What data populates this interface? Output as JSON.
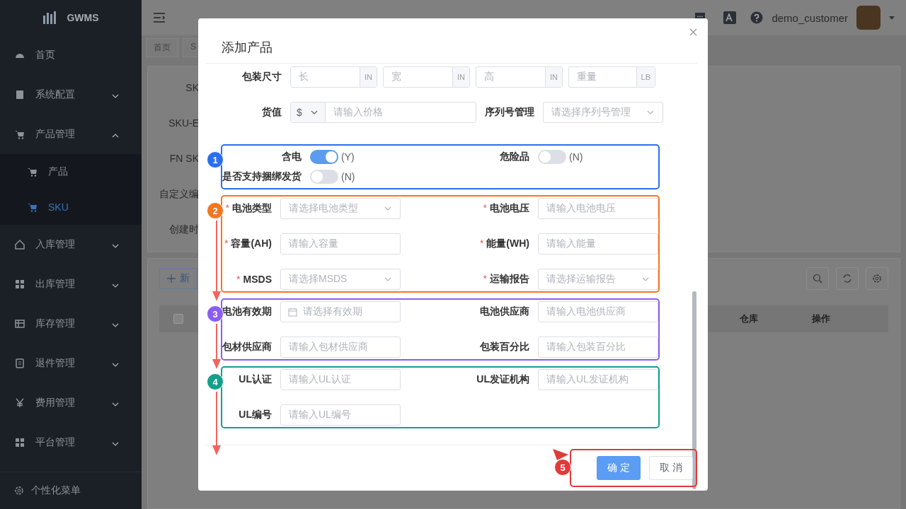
{
  "sidebar": {
    "logo": "GWMS",
    "items": [
      {
        "label": "首页",
        "kind": "link"
      },
      {
        "label": "系统配置",
        "kind": "group",
        "expanded": false
      },
      {
        "label": "产品管理",
        "kind": "group",
        "expanded": true,
        "children": [
          {
            "label": "产品",
            "selected": false
          },
          {
            "label": "SKU",
            "selected": true
          }
        ]
      },
      {
        "label": "入库管理",
        "kind": "group",
        "expanded": false
      },
      {
        "label": "出库管理",
        "kind": "group",
        "expanded": false
      },
      {
        "label": "库存管理",
        "kind": "group",
        "expanded": false
      },
      {
        "label": "退件管理",
        "kind": "group",
        "expanded": false
      },
      {
        "label": "费用管理",
        "kind": "group",
        "expanded": false
      },
      {
        "label": "平台管理",
        "kind": "group",
        "expanded": false
      }
    ],
    "footer": "个性化菜单"
  },
  "header": {
    "user": "demo_customer"
  },
  "breadcrumb_tabs": [
    "首页",
    "S"
  ],
  "filter_labels": [
    "SK",
    "SKU-E",
    "FN SK",
    "自定义编",
    "创建时"
  ],
  "toolbar": {
    "add_button": "新"
  },
  "table": {
    "checked": false,
    "columns": [
      "仓库",
      "操作"
    ]
  },
  "dialog": {
    "title": "添加产品",
    "package_row": {
      "label": "包装尺寸",
      "inputs": [
        {
          "placeholder": "长",
          "unit": "IN"
        },
        {
          "placeholder": "宽",
          "unit": "IN"
        },
        {
          "placeholder": "高",
          "unit": "IN"
        },
        {
          "placeholder": "重量",
          "unit": "LB"
        }
      ]
    },
    "value_row": {
      "label": "货值",
      "currency": "$",
      "placeholder": "请输入价格",
      "serial_label": "序列号管理",
      "serial_placeholder": "请选择序列号管理"
    },
    "sections": [
      {
        "badge": "1",
        "color": "#2b6ef2",
        "arrow": false,
        "fields": [
          {
            "kind": "switch",
            "label": "含电",
            "on": true,
            "text": "(Y)"
          },
          {
            "kind": "switch",
            "label": "危险品",
            "on": false,
            "text": "(N)"
          },
          {
            "kind": "switch",
            "label": "是否支持捆绑发货",
            "on": false,
            "text": "(N)"
          }
        ]
      },
      {
        "badge": "2",
        "color": "#f5761f",
        "arrow": true,
        "fields": [
          {
            "kind": "select",
            "label": "电池类型",
            "mark": "*",
            "placeholder": "请选择电池类型"
          },
          {
            "kind": "input",
            "label": "电池电压",
            "mark": "*",
            "placeholder": "请输入电池电压"
          },
          {
            "kind": "input",
            "label": "容量(AH)",
            "mark": "*",
            "placeholder": "请输入容量"
          },
          {
            "kind": "input",
            "label": "能量(WH)",
            "mark": "*",
            "placeholder": "请输入能量"
          },
          {
            "kind": "select",
            "label": "MSDS",
            "mark": "*",
            "placeholder": "请选择MSDS"
          },
          {
            "kind": "select",
            "label": "运输报告",
            "mark": "*",
            "placeholder": "请选择运输报告"
          }
        ]
      },
      {
        "badge": "3",
        "color": "#8b5cf0",
        "arrow": true,
        "fields": [
          {
            "kind": "date",
            "label": "电池有效期",
            "placeholder": "请选择有效期"
          },
          {
            "kind": "input",
            "label": "电池供应商",
            "placeholder": "请输入电池供应商"
          },
          {
            "kind": "input",
            "label": "包材供应商",
            "placeholder": "请输入包材供应商"
          },
          {
            "kind": "input",
            "label": "包装百分比",
            "placeholder": "请输入包装百分比"
          }
        ]
      },
      {
        "badge": "4",
        "color": "#14a08a",
        "arrow": true,
        "fields": [
          {
            "kind": "input",
            "label": "UL认证",
            "placeholder": "请输入UL认证"
          },
          {
            "kind": "input",
            "label": "UL发证机构",
            "placeholder": "请输入UL发证机构"
          },
          {
            "kind": "input",
            "label": "UL编号",
            "placeholder": "请输入UL编号"
          }
        ]
      }
    ],
    "footer": {
      "badge": "5",
      "color": "#e03a3a",
      "buttons": [
        {
          "label": "确 定",
          "kind": "primary"
        },
        {
          "label": "取 消",
          "kind": "default"
        }
      ]
    }
  }
}
